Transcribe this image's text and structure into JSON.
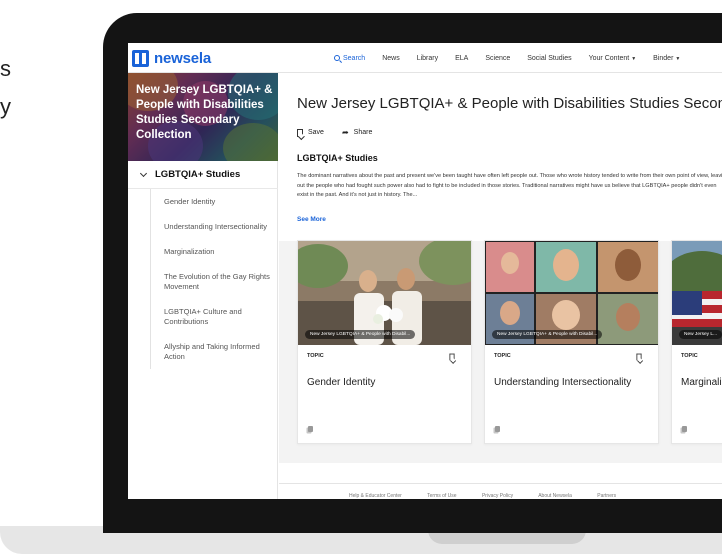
{
  "background": {
    "edge_letters": [
      "s",
      "y"
    ]
  },
  "topnav": {
    "logo_text": "newsela",
    "items": [
      {
        "label": "Search"
      },
      {
        "label": "News"
      },
      {
        "label": "Library"
      },
      {
        "label": "ELA"
      },
      {
        "label": "Science"
      },
      {
        "label": "Social Studies"
      },
      {
        "label": "Your Content"
      },
      {
        "label": "Binder"
      }
    ]
  },
  "sidebar": {
    "collection_title": "New Jersey LGBTQIA+ & People with Disabilities Studies Secondary Collection",
    "section_title": "LGBTQIA+ Studies",
    "items": [
      {
        "label": "Gender Identity"
      },
      {
        "label": "Understanding Intersectionality"
      },
      {
        "label": "Marginalization"
      },
      {
        "label": "The Evolution of the Gay Rights Movement"
      },
      {
        "label": "LGBTQIA+ Culture and Contributions"
      },
      {
        "label": "Allyship and Taking Informed Action"
      }
    ]
  },
  "main": {
    "title": "New Jersey LGBTQIA+ & People with Disabilities Studies Secondary Collection",
    "actions": {
      "save_label": "Save",
      "share_label": "Share"
    },
    "section_title": "LGBTQIA+ Studies",
    "description": "The dominant narratives about the past and present we've been taught have often left people out. Those who wrote history tended to write from their own point of view, leaving out the people who had fought such power also had to fight to be included in those stories. Traditional narratives might have us believe that LGBTQIA+ people didn't even exist in the past. And it's not just in history. The...",
    "see_more": "See More",
    "cards": [
      {
        "topic": "TOPIC",
        "title": "Gender Identity",
        "image_caption": "New Jersey LGBTQIA+ & People with Disabil..."
      },
      {
        "topic": "TOPIC",
        "title": "Understanding Intersectionality",
        "image_caption": "New Jersey LGBTQIA+ & People with Disabil..."
      },
      {
        "topic": "TOPIC",
        "title": "Marginalization",
        "image_caption": "New Jersey L..."
      }
    ]
  },
  "footer": {
    "links": [
      "Help & Educator Center",
      "Terms of Use",
      "Privacy Policy",
      "About Newsela",
      "Partners"
    ]
  },
  "colors": {
    "brand": "#1a63d8",
    "bezel": "#141414",
    "page_bg": "#f3f3f3"
  }
}
